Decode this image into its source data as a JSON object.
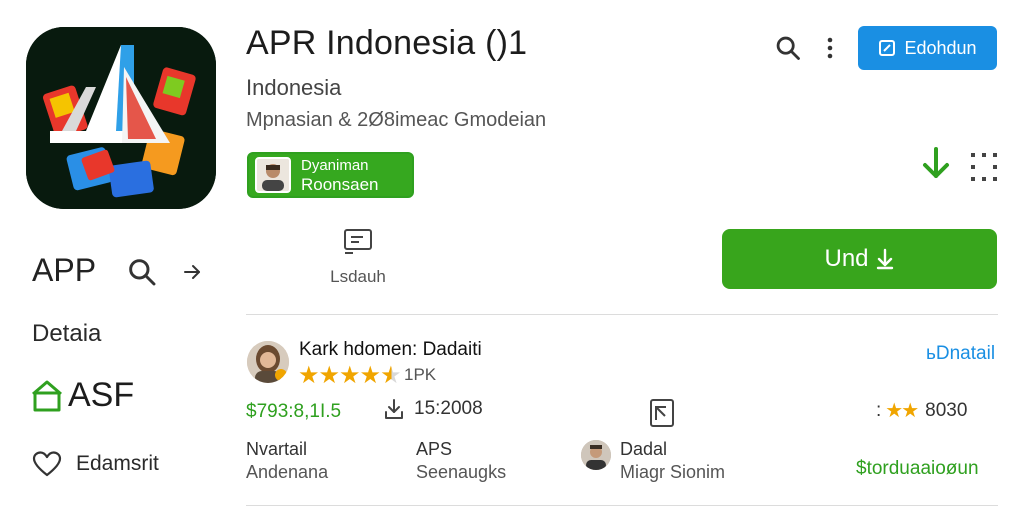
{
  "header": {
    "app_title": "APR Indonesia",
    "title_suffix": "(‌)1",
    "subtitle": "Indonesia",
    "publisher": "Mpnasian & 2Ø8imeac Gmodeian",
    "edit_label": "Edohdun"
  },
  "developer_badge": {
    "line1": "Dyaniman",
    "line2": "Roonsaen"
  },
  "sidebar": {
    "app_label": "APP",
    "details_label": "Detaia",
    "age_label": "ASF",
    "wishlist_label": "Edamsrit"
  },
  "actions": {
    "middle_label": "Lsdauh",
    "install_label": "Und"
  },
  "review": {
    "reviewer": "Kark hdomen: Dadaiti",
    "stars": 4.5,
    "count": "1PK",
    "detail_link": "ьDnatail"
  },
  "stats": {
    "price": "$793:8,1I.5",
    "downloads": "15:2008",
    "rating_value": "8030",
    "rating_stars": "★★",
    "rating_prefix": ":"
  },
  "info": {
    "col1_title": "Nvartail",
    "col1_sub": "Andenana",
    "col2_title": "APS",
    "col2_sub": "Seenaugks",
    "col3_title": "Dadal",
    "col3_sub": "Miagr Sionim",
    "more_link": "$torduaaioøun"
  },
  "icons": {
    "search": "search-icon",
    "more": "more-vertical-icon",
    "edit": "edit-icon",
    "download": "download-arrow-icon",
    "grid": "dotted-grid-icon",
    "arrow": "arrow-right-icon",
    "age_shield": "shield-house-icon",
    "heart": "heart-icon",
    "doc": "document-icon",
    "downloads": "download-icon"
  },
  "colors": {
    "primary_green": "#38a51c",
    "link_blue": "#1a8fe3",
    "star": "#f0a500"
  }
}
